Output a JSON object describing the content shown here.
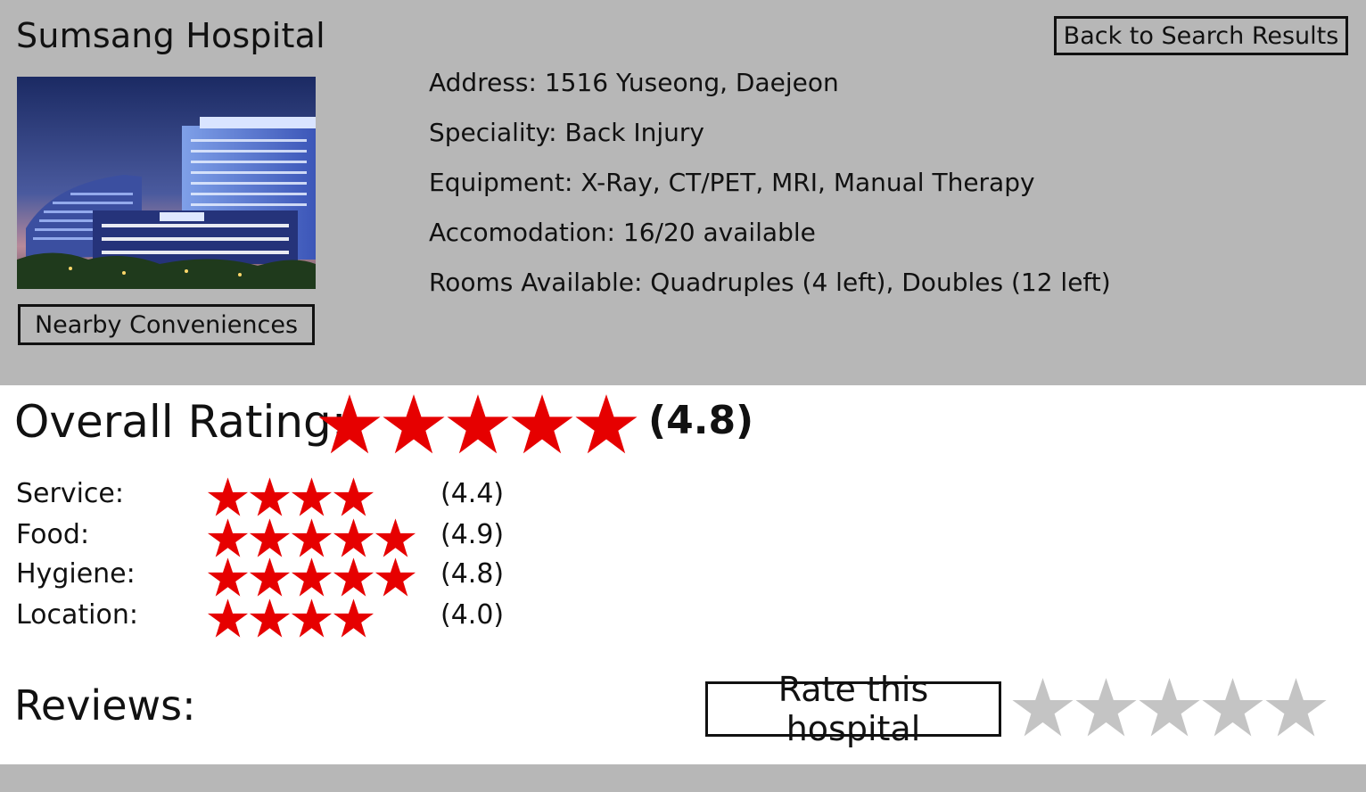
{
  "hospital": {
    "name": "Sumsang Hospital",
    "back_label": "Back to Search Results",
    "nearby_label": "Nearby Conveniences",
    "details": [
      "Address: 1516 Yuseong, Daejeon",
      "Speciality: Back Injury",
      "Equipment: X-Ray, CT/PET, MRI, Manual Therapy",
      "Accomodation: 16/20 available",
      "Rooms Available: Quadruples (4 left), Doubles (12 left)"
    ]
  },
  "ratings": {
    "overall_label": "Overall Rating:",
    "overall_value": "(4.8)",
    "overall_stars": 5,
    "categories": [
      {
        "label": "Service:",
        "value": "(4.4)",
        "stars": 4
      },
      {
        "label": "Food:",
        "value": "(4.9)",
        "stars": 5
      },
      {
        "label": "Hygiene:",
        "value": "(4.8)",
        "stars": 5
      },
      {
        "label": "Location:",
        "value": "(4.0)",
        "stars": 4
      }
    ]
  },
  "reviews": {
    "label": "Reviews:",
    "rate_label": "Rate this hospital",
    "rate_stars": 5
  },
  "colors": {
    "panel": "#b7b7b7",
    "star_filled": "#e60000",
    "star_empty": "#c4c4c4"
  }
}
